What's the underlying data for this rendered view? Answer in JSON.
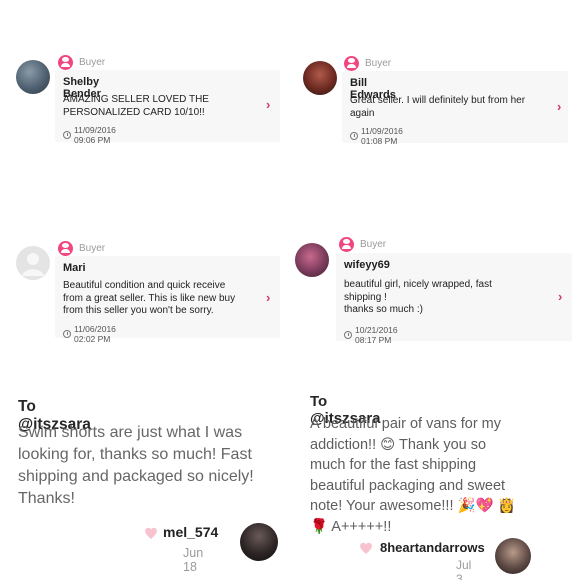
{
  "reviews": [
    {
      "badge_label": "Buyer",
      "name": "Shelby Bender",
      "message": "AMAZING SELLER LOVED THE\nPERSONALIZED CARD 10/10!!",
      "date": "11/09/2016 09:06 PM",
      "chevron": "›",
      "avatar_icon": "profile-photo-icon"
    },
    {
      "badge_label": "Buyer",
      "name": "Bill Edwards",
      "message": "Great seller. I will definitely but from her\nagain",
      "date": "11/09/2016 01:08 PM",
      "chevron": "›",
      "avatar_icon": "profile-photo-icon"
    },
    {
      "badge_label": "Buyer",
      "name": "Mari",
      "message": "Beautiful condition and quick receive\nfrom a great seller.  This is like new buy\nfrom this seller you won't be sorry.",
      "date": "11/06/2016 02:02 PM",
      "chevron": "›",
      "avatar_icon": "default-user-icon"
    },
    {
      "badge_label": "Buyer",
      "name": "wifeyy69",
      "message": "beautiful girl, nicely wrapped, fast\nshipping !\nthanks so much :)",
      "date": "10/21/2016 08:17 PM",
      "chevron": "›",
      "avatar_icon": "profile-photo-icon"
    }
  ],
  "notes": [
    {
      "to": "To @itszsara",
      "body": "Swim shorts are just what I was looking for, thanks so much! Fast shipping and packaged so nicely! Thanks!",
      "signer": "mel_574",
      "date": "Jun 18"
    },
    {
      "to": "To @itszsara",
      "body": "A beautiful pair of vans for my addiction!! 😊 Thank you so much for the fast shipping beautiful packaging and sweet note! Your awesome!!! 🎉💖 👸🌹 A+++++!!",
      "signer": "8heartandarrows",
      "date": "Jul 3"
    }
  ],
  "colors": {
    "badge_pink": "#f0487e",
    "chevron_red": "#d43a63",
    "heart_pink": "#f6c3cf"
  }
}
